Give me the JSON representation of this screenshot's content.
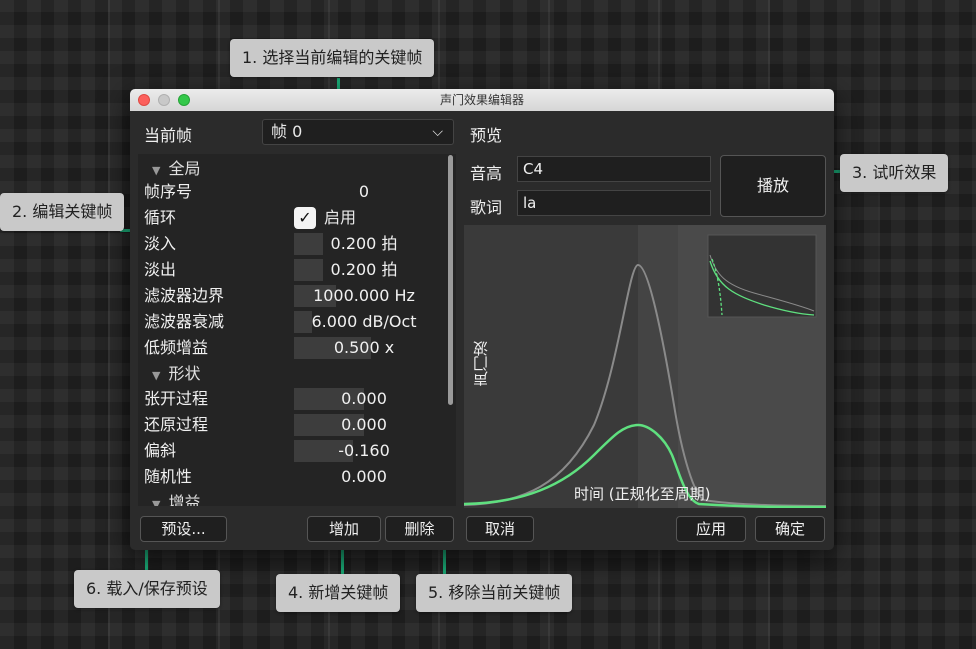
{
  "callouts": {
    "c1": "1. 选择当前编辑的关键帧",
    "c2": "2. 编辑关键帧",
    "c3": "3. 试听效果",
    "c4": "4. 新增关键帧",
    "c5": "5. 移除当前关键帧",
    "c6": "6. 载入/保存预设"
  },
  "window": {
    "title": "声门效果编辑器",
    "current_frame_label": "当前帧",
    "current_frame_value": "帧 0",
    "preview_label": "预览",
    "pitch_label": "音高",
    "pitch_value": "C4",
    "lyric_label": "歌词",
    "lyric_value": "la",
    "play_button": "播放",
    "plot_ylabel": "声门波",
    "plot_xlabel": "时间 (正规化至周期)"
  },
  "properties": {
    "section_global": "全局",
    "frame_index_label": "帧序号",
    "frame_index_value": "0",
    "loop_label": "循环",
    "loop_checkbox_text": "启用",
    "loop_checked": true,
    "fade_in_label": "淡入",
    "fade_in_value": "0.200 拍",
    "fade_in_level": 0.21,
    "fade_out_label": "淡出",
    "fade_out_value": "0.200 拍",
    "fade_out_level": 0.21,
    "filter_boundary_label": "滤波器边界",
    "filter_boundary_value": "1000.000 Hz",
    "filter_boundary_level": 0.3,
    "filter_decay_label": "滤波器衰减",
    "filter_decay_value": "6.000 dB/Oct",
    "filter_decay_level": 0.13,
    "low_gain_label": "低频增益",
    "low_gain_value": "0.500 x",
    "low_gain_level": 0.55,
    "section_shape": "形状",
    "open_label": "张开过程",
    "open_value": "0.000",
    "open_level": 0.5,
    "return_label": "还原过程",
    "return_value": "0.000",
    "return_level": 0.5,
    "skew_label": "偏斜",
    "skew_value": "-0.160",
    "skew_level": 0.42,
    "random_label": "随机性",
    "random_value": "0.000",
    "random_level": 0.0,
    "section_gain": "增益"
  },
  "buttons": {
    "preset": "预设...",
    "add": "增加",
    "delete": "删除",
    "cancel": "取消",
    "apply": "应用",
    "ok": "确定"
  },
  "colors": {
    "accent_line": "#1bb27c",
    "wave_green": "#5fe07f",
    "wave_gray": "#8a8a8a"
  }
}
